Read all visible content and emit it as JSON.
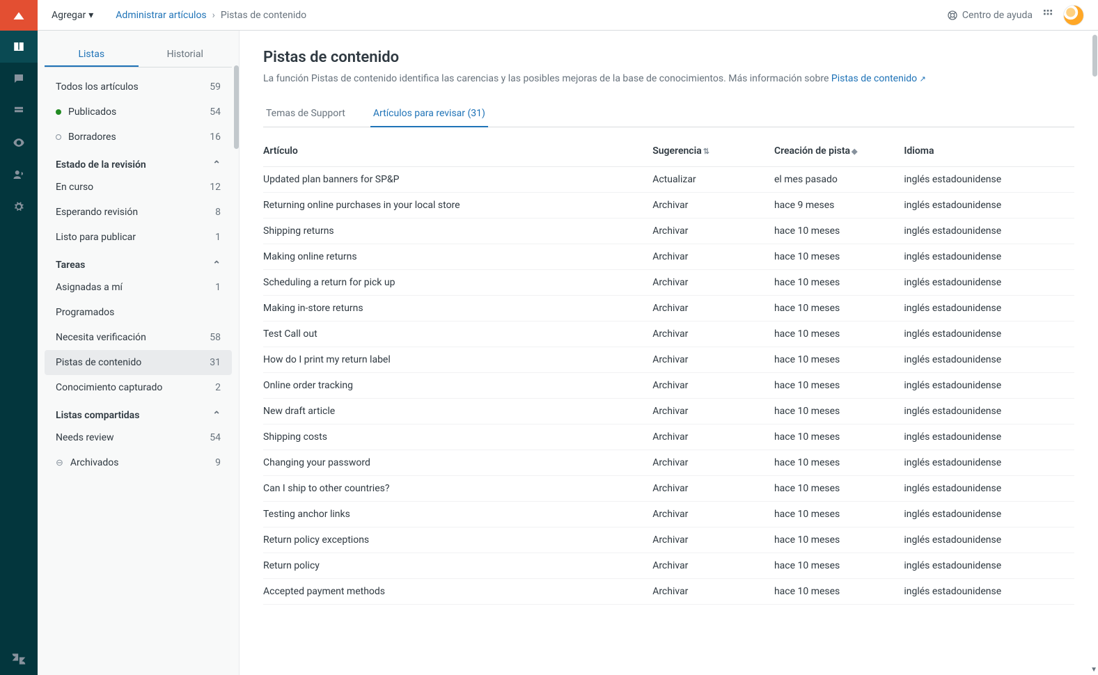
{
  "topbar": {
    "add_label": "Agregar",
    "breadcrumb_root": "Administrar artículos",
    "breadcrumb_current": "Pistas de contenido",
    "help_label": "Centro de ayuda"
  },
  "side_tabs": {
    "lists": "Listas",
    "history": "Historial"
  },
  "sidebar": {
    "all_articles": {
      "label": "Todos los artículos",
      "count": "59"
    },
    "published": {
      "label": "Publicados",
      "count": "54"
    },
    "drafts": {
      "label": "Borradores",
      "count": "16"
    },
    "section_review": "Estado de la revisión",
    "in_progress": {
      "label": "En curso",
      "count": "12"
    },
    "awaiting": {
      "label": "Esperando revisión",
      "count": "8"
    },
    "ready": {
      "label": "Listo para publicar",
      "count": "1"
    },
    "section_tasks": "Tareas",
    "assigned": {
      "label": "Asignadas a mí",
      "count": "1"
    },
    "scheduled": {
      "label": "Programados",
      "count": ""
    },
    "needs_verif": {
      "label": "Necesita verificación",
      "count": "58"
    },
    "content_cues": {
      "label": "Pistas de contenido",
      "count": "31"
    },
    "captured": {
      "label": "Conocimiento capturado",
      "count": "2"
    },
    "section_shared": "Listas compartidas",
    "needs_review": {
      "label": "Needs review",
      "count": "54"
    },
    "archived": {
      "label": "Archivados",
      "count": "9"
    }
  },
  "main": {
    "title": "Pistas de contenido",
    "description_prefix": "La función Pistas de contenido identifica las carencias y las posibles mejoras de la base de conocimientos. Más información sobre ",
    "description_link": "Pistas de contenido",
    "tab_support": "Temas de Support",
    "tab_review": "Artículos para revisar (31)",
    "columns": {
      "article": "Artículo",
      "suggestion": "Sugerencia",
      "created": "Creación de pista",
      "language": "Idioma"
    },
    "rows": [
      {
        "article": "Updated plan banners for SP&P",
        "suggestion": "Actualizar",
        "created": "el mes pasado",
        "language": "inglés estadounidense"
      },
      {
        "article": "Returning online purchases in your local store",
        "suggestion": "Archivar",
        "created": "hace 9 meses",
        "language": "inglés estadounidense"
      },
      {
        "article": "Shipping returns",
        "suggestion": "Archivar",
        "created": "hace 10 meses",
        "language": "inglés estadounidense"
      },
      {
        "article": "Making online returns",
        "suggestion": "Archivar",
        "created": "hace 10 meses",
        "language": "inglés estadounidense"
      },
      {
        "article": "Scheduling a return for pick up",
        "suggestion": "Archivar",
        "created": "hace 10 meses",
        "language": "inglés estadounidense"
      },
      {
        "article": "Making in-store returns",
        "suggestion": "Archivar",
        "created": "hace 10 meses",
        "language": "inglés estadounidense"
      },
      {
        "article": "Test Call out",
        "suggestion": "Archivar",
        "created": "hace 10 meses",
        "language": "inglés estadounidense"
      },
      {
        "article": "How do I print my return label",
        "suggestion": "Archivar",
        "created": "hace 10 meses",
        "language": "inglés estadounidense"
      },
      {
        "article": "Online order tracking",
        "suggestion": "Archivar",
        "created": "hace 10 meses",
        "language": "inglés estadounidense"
      },
      {
        "article": "New draft article",
        "suggestion": "Archivar",
        "created": "hace 10 meses",
        "language": "inglés estadounidense"
      },
      {
        "article": "Shipping costs",
        "suggestion": "Archivar",
        "created": "hace 10 meses",
        "language": "inglés estadounidense"
      },
      {
        "article": "Changing your password",
        "suggestion": "Archivar",
        "created": "hace 10 meses",
        "language": "inglés estadounidense"
      },
      {
        "article": "Can I ship to other countries?",
        "suggestion": "Archivar",
        "created": "hace 10 meses",
        "language": "inglés estadounidense"
      },
      {
        "article": "Testing anchor links",
        "suggestion": "Archivar",
        "created": "hace 10 meses",
        "language": "inglés estadounidense"
      },
      {
        "article": "Return policy exceptions",
        "suggestion": "Archivar",
        "created": "hace 10 meses",
        "language": "inglés estadounidense"
      },
      {
        "article": "Return policy",
        "suggestion": "Archivar",
        "created": "hace 10 meses",
        "language": "inglés estadounidense"
      },
      {
        "article": "Accepted payment methods",
        "suggestion": "Archivar",
        "created": "hace 10 meses",
        "language": "inglés estadounidense"
      }
    ]
  }
}
